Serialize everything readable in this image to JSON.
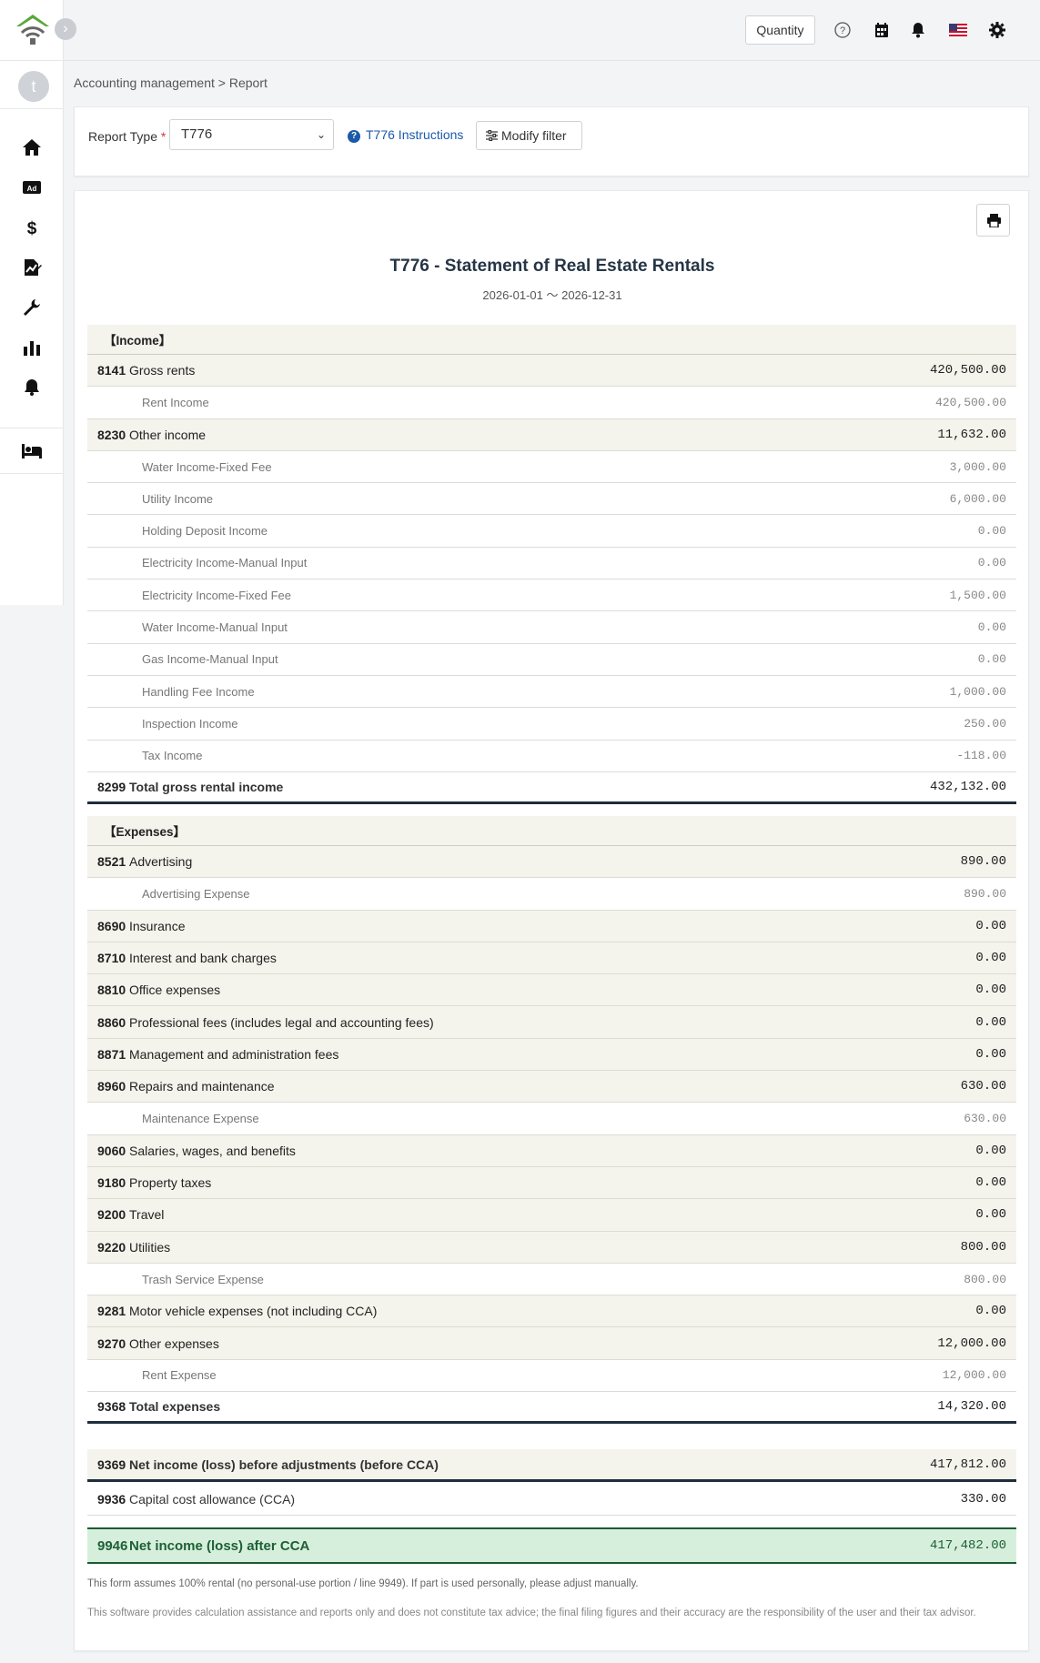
{
  "topbar": {
    "quantity_label": "Quantity"
  },
  "sidebar": {
    "avatar_initial": "t",
    "nav_icons": [
      "home-icon",
      "ad-icon",
      "dollar-icon",
      "chart-file-icon",
      "wrench-icon",
      "bar-chart-icon",
      "bell-icon",
      "bed-icon"
    ]
  },
  "breadcrumb": {
    "root": "Accounting management",
    "separator": ">",
    "current": "Report"
  },
  "filter": {
    "report_type_label": "Report Type",
    "required_mark": "*",
    "report_type_value": "T776",
    "instructions_label": "T776 Instructions",
    "modify_label": "Modify filter"
  },
  "report": {
    "title": "T776 - Statement of Real Estate Rentals",
    "period": "2026-01-01 〜 2026-12-31",
    "income_header": "【Income】",
    "income_rows": [
      {
        "type": "cat",
        "code": "8141",
        "label": "Gross rents",
        "amount": "420,500.00"
      },
      {
        "type": "sub",
        "label": "Rent Income",
        "amount": "420,500.00"
      },
      {
        "type": "cat",
        "code": "8230",
        "label": "Other income",
        "amount": "11,632.00"
      },
      {
        "type": "sub",
        "label": "Water Income-Fixed Fee",
        "amount": "3,000.00"
      },
      {
        "type": "sub",
        "label": "Utility Income",
        "amount": "6,000.00"
      },
      {
        "type": "sub",
        "label": "Holding Deposit Income",
        "amount": "0.00"
      },
      {
        "type": "sub",
        "label": "Electricity Income-Manual Input",
        "amount": "0.00"
      },
      {
        "type": "sub",
        "label": "Electricity Income-Fixed Fee",
        "amount": "1,500.00"
      },
      {
        "type": "sub",
        "label": "Water Income-Manual Input",
        "amount": "0.00"
      },
      {
        "type": "sub",
        "label": "Gas Income-Manual Input",
        "amount": "0.00"
      },
      {
        "type": "sub",
        "label": "Handling Fee Income",
        "amount": "1,000.00"
      },
      {
        "type": "sub",
        "label": "Inspection Income",
        "amount": "250.00"
      },
      {
        "type": "sub",
        "label": "Tax Income",
        "amount": "-118.00"
      },
      {
        "type": "total",
        "code": "8299",
        "label": "Total gross rental income",
        "amount": "432,132.00"
      }
    ],
    "expenses_header": "【Expenses】",
    "expense_rows": [
      {
        "type": "cat",
        "code": "8521",
        "label": "Advertising",
        "amount": "890.00"
      },
      {
        "type": "sub",
        "label": "Advertising Expense",
        "amount": "890.00"
      },
      {
        "type": "cat",
        "code": "8690",
        "label": "Insurance",
        "amount": "0.00"
      },
      {
        "type": "cat",
        "code": "8710",
        "label": "Interest and bank charges",
        "amount": "0.00"
      },
      {
        "type": "cat",
        "code": "8810",
        "label": "Office expenses",
        "amount": "0.00"
      },
      {
        "type": "cat",
        "code": "8860",
        "label": "Professional fees (includes legal and accounting fees)",
        "amount": "0.00"
      },
      {
        "type": "cat",
        "code": "8871",
        "label": "Management and administration fees",
        "amount": "0.00"
      },
      {
        "type": "cat",
        "code": "8960",
        "label": "Repairs and maintenance",
        "amount": "630.00"
      },
      {
        "type": "sub",
        "label": "Maintenance Expense",
        "amount": "630.00"
      },
      {
        "type": "cat",
        "code": "9060",
        "label": "Salaries, wages, and benefits",
        "amount": "0.00"
      },
      {
        "type": "cat",
        "code": "9180",
        "label": "Property taxes",
        "amount": "0.00"
      },
      {
        "type": "cat",
        "code": "9200",
        "label": "Travel",
        "amount": "0.00"
      },
      {
        "type": "cat",
        "code": "9220",
        "label": "Utilities",
        "amount": "800.00"
      },
      {
        "type": "sub",
        "label": "Trash Service Expense",
        "amount": "800.00"
      },
      {
        "type": "cat",
        "code": "9281",
        "label": "Motor vehicle expenses (not including CCA)",
        "amount": "0.00"
      },
      {
        "type": "cat",
        "code": "9270",
        "label": "Other expenses",
        "amount": "12,000.00"
      },
      {
        "type": "sub",
        "label": "Rent Expense",
        "amount": "12,000.00"
      },
      {
        "type": "total",
        "code": "9368",
        "label": "Total expenses",
        "amount": "14,320.00"
      }
    ],
    "net_before": {
      "code": "9369",
      "label": "Net income (loss) before adjustments (before CCA)",
      "amount": "417,812.00"
    },
    "cca": {
      "code": "9936",
      "label": "Capital cost allowance (CCA)",
      "amount": "330.00"
    },
    "net_after": {
      "code": "9946",
      "label": "Net income (loss) after CCA",
      "amount": "417,482.00"
    },
    "note1": "This form assumes 100% rental (no personal-use portion / line 9949). If part is used personally, please adjust manually.",
    "note2": "This software provides calculation assistance and reports only and does not constitute tax advice; the final filing figures and their accuracy are the responsibility of the user and their tax advisor."
  }
}
